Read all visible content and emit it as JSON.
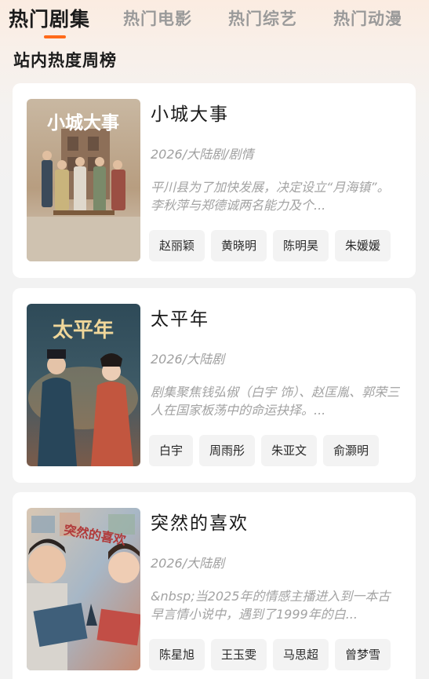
{
  "tabs": [
    {
      "label": "热门剧集",
      "active": true
    },
    {
      "label": "热门电影",
      "active": false
    },
    {
      "label": "热门综艺",
      "active": false
    },
    {
      "label": "热门动漫",
      "active": false
    }
  ],
  "section_title": "站内热度周榜",
  "accent_color": "#ff6a1a",
  "shows": [
    {
      "title": "小城大事",
      "meta": "2026/大陆剧/剧情",
      "description": "平川县为了加快发展，决定设立“月海镇”。李秋萍与郑德诚两名能力及个...",
      "cast": [
        "赵丽颖",
        "黄晓明",
        "陈明昊",
        "朱媛媛"
      ],
      "poster_text": "小城大事"
    },
    {
      "title": "太平年",
      "meta": "2026/大陆剧",
      "description": "剧集聚焦钱弘俶（白宇 饰）、赵匡胤、郭荣三人在国家板荡中的命运抉择。...",
      "cast": [
        "白宇",
        "周雨彤",
        "朱亚文",
        "俞灏明"
      ],
      "poster_text": "太平年"
    },
    {
      "title": "突然的喜欢",
      "meta": "2026/大陆剧",
      "description": "&nbsp;当2025年的情感主播进入到一本古早言情小说中，遇到了1999年的白...",
      "cast": [
        "陈星旭",
        "王玉雯",
        "马思超",
        "曾梦雪"
      ],
      "poster_text": "突然的喜欢"
    }
  ]
}
